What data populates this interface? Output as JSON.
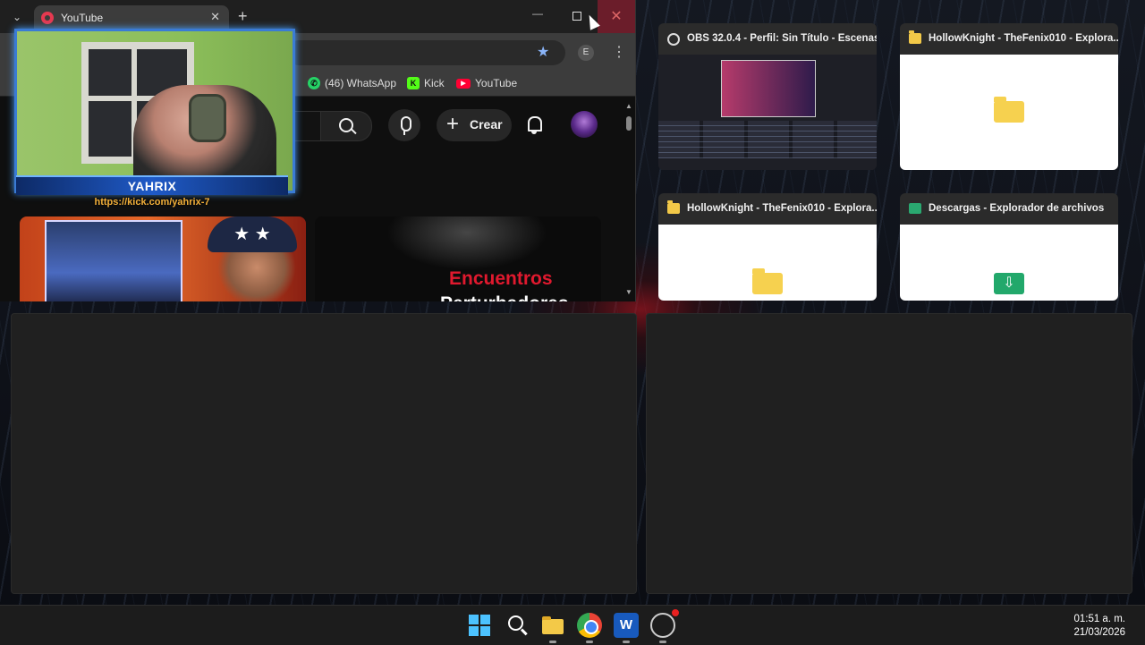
{
  "browser": {
    "tab_title": "YouTube",
    "new_tab_symbol": "+",
    "profile_initial": "E",
    "bookmarks": [
      {
        "label": "(46) WhatsApp",
        "icon": "whatsapp-icon"
      },
      {
        "label": "Kick",
        "icon": "kick-icon"
      },
      {
        "label": "YouTube",
        "icon": "youtube-icon"
      }
    ],
    "youtube": {
      "create_label": "Crear",
      "video2_title_line1": "Encuentros",
      "video2_title_line2": "Perturbadores"
    }
  },
  "webcam": {
    "streamer_name": "YAHRIX",
    "link": "https://kick.com/yahrix-7"
  },
  "task_view": {
    "windows": [
      {
        "title": "OBS 32.0.4 - Perfil: Sin Título - Escenas...",
        "icon": "obs-icon"
      },
      {
        "title": "HollowKnight - TheFenix010 - Explora...",
        "icon": "folder-icon"
      },
      {
        "title": "HollowKnight - TheFenix010 - Explora...",
        "icon": "folder-icon"
      },
      {
        "title": "Descargas - Explorador de archivos",
        "icon": "downloads-folder-icon"
      }
    ]
  },
  "taskbar": {
    "apps": [
      "start-icon",
      "search-icon",
      "file-explorer-icon",
      "chrome-icon",
      "word-icon",
      "obs-icon"
    ],
    "word_letter": "W",
    "time": "01:51 a. m.",
    "date": "21/03/2026"
  },
  "colors": {
    "accent_blue": "#3a7bd5",
    "youtube_red": "#ff0033",
    "kick_green": "#53fc18",
    "whatsapp_green": "#25d366"
  }
}
